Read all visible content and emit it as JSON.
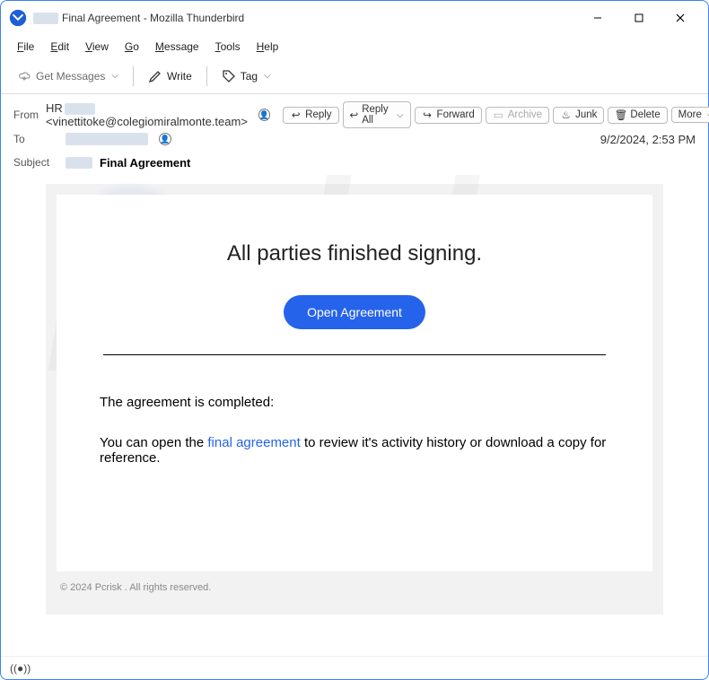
{
  "window": {
    "title": "Final Agreement - Mozilla Thunderbird"
  },
  "menu": [
    "File",
    "Edit",
    "View",
    "Go",
    "Message",
    "Tools",
    "Help"
  ],
  "toolbar": {
    "get_messages": "Get Messages",
    "write": "Write",
    "tag": "Tag"
  },
  "header": {
    "from_label": "From",
    "from_prefix": "HR",
    "from_email": "<vinettitoke@colegiomiralmonte.team>",
    "to_label": "To",
    "subject_label": "Subject",
    "subject_value": "Final Agreement",
    "date": "9/2/2024, 2:53 PM"
  },
  "actions": {
    "reply": "Reply",
    "reply_all": "Reply All",
    "forward": "Forward",
    "archive": "Archive",
    "junk": "Junk",
    "delete": "Delete",
    "more": "More"
  },
  "email": {
    "headline": "All parties finished signing.",
    "cta": "Open Agreement",
    "completed_text": "The agreement is completed:",
    "body_prefix": "You can open the ",
    "body_link": "final agreement",
    "body_suffix": " to review it's activity history or download a copy for reference.",
    "footer": "© 2024 Pcrisk . All rights reserved."
  }
}
